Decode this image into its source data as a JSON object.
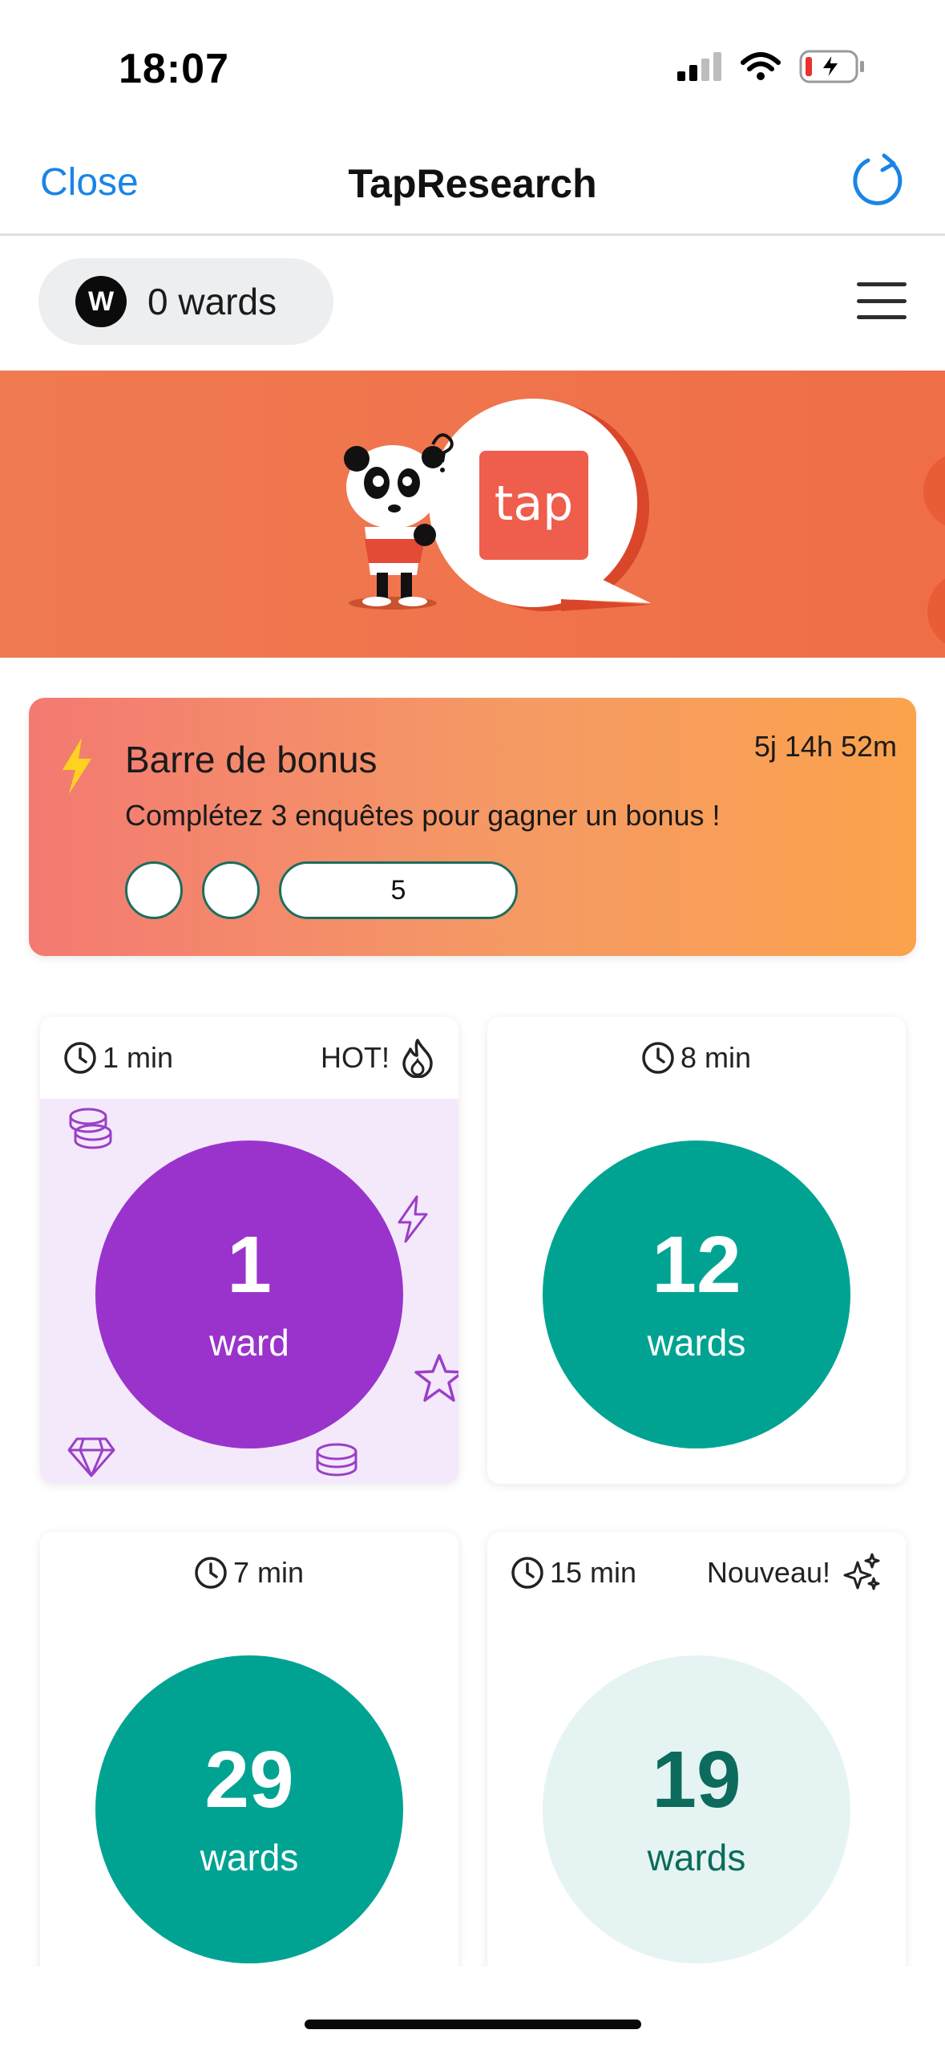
{
  "status_bar": {
    "time": "18:07"
  },
  "nav": {
    "close_label": "Close",
    "title": "TapResearch"
  },
  "wallet": {
    "logo_letter": "W",
    "balance": "0 wards"
  },
  "banner": {
    "logo_text": "tap",
    "bg_color": "#ef7249"
  },
  "bonus": {
    "title": "Barre de bonus",
    "timer": "5j 14h 52m",
    "description": "Complétez 3 enquêtes pour gagner un bonus !",
    "final_step_value": "5"
  },
  "surveys": [
    {
      "duration": "1 min",
      "tag": "HOT!",
      "tag_icon": "flame-icon",
      "reward": "1",
      "unit": "ward",
      "color": "#9a33cc"
    },
    {
      "duration": "8 min",
      "tag": "",
      "reward": "12",
      "unit": "wards",
      "color": "#00a392"
    },
    {
      "duration": "7 min",
      "tag": "",
      "reward": "29",
      "unit": "wards",
      "color": "#00a392"
    },
    {
      "duration": "15 min",
      "tag": "Nouveau!",
      "tag_icon": "sparkles-icon",
      "reward": "19",
      "unit": "wards",
      "color": "#e5f4f2"
    }
  ],
  "colors": {
    "accent_blue": "#1a84e6",
    "teal": "#00a392",
    "purple": "#9a33cc"
  }
}
